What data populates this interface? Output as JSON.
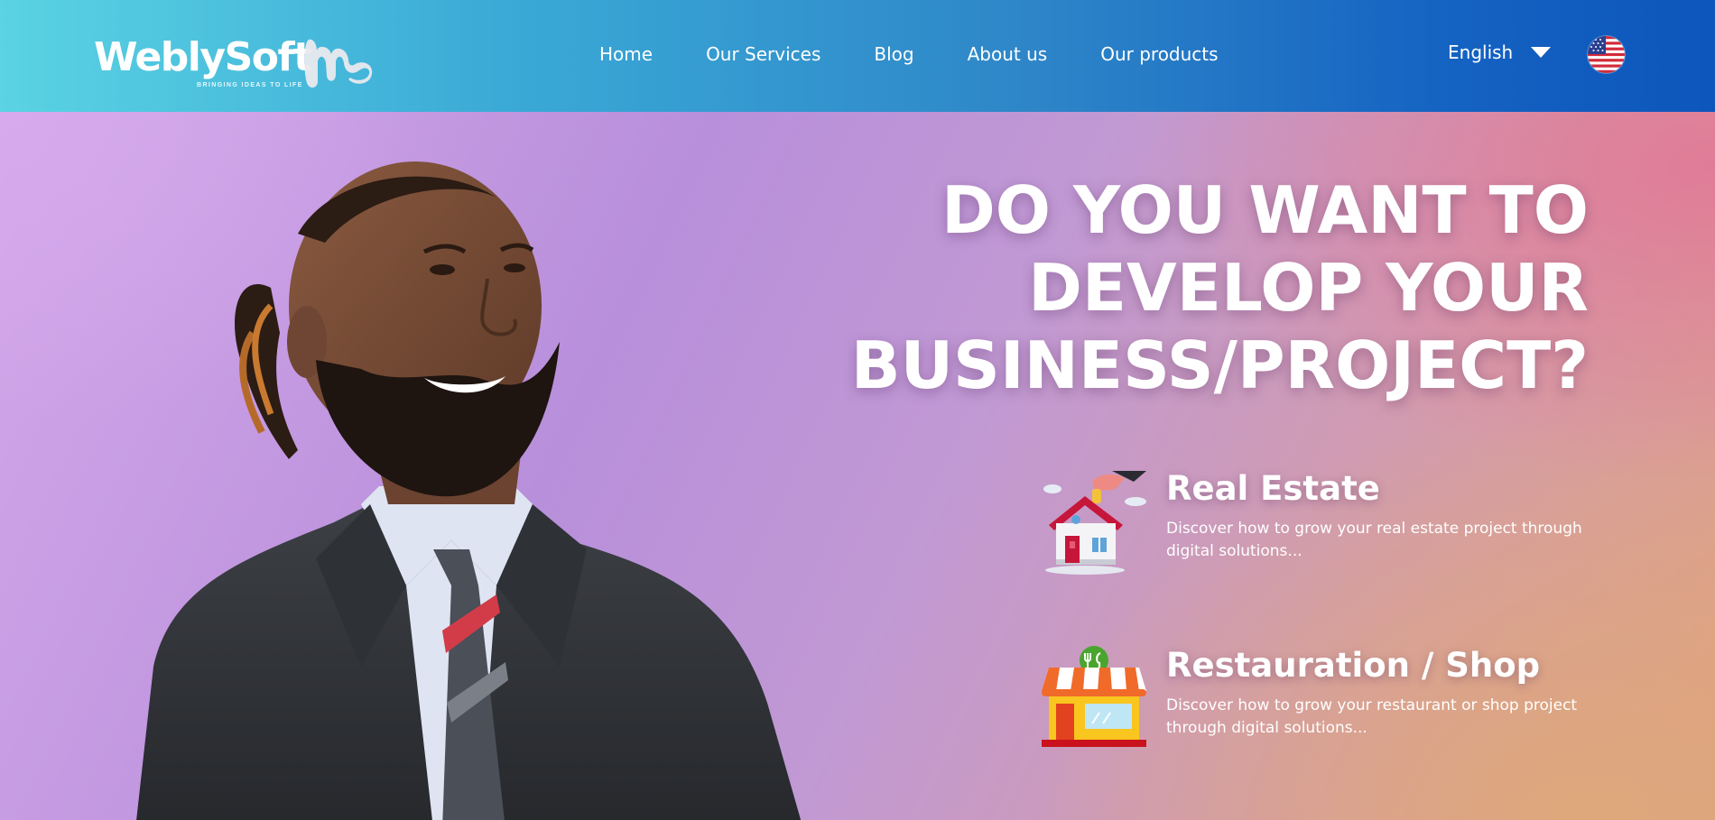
{
  "brand": {
    "name": "WeblySoft",
    "tagline": "BRINGING IDEAS TO LIFE"
  },
  "nav": {
    "items": [
      {
        "label": "Home"
      },
      {
        "label": "Our Services"
      },
      {
        "label": "Blog"
      },
      {
        "label": "About us"
      },
      {
        "label": "Our products"
      }
    ]
  },
  "language": {
    "selected": "English",
    "flag_icon": "us-flag-icon"
  },
  "hero": {
    "headline_lines": [
      "DO YOU WANT TO",
      "DEVELOP YOUR",
      "BUSINESS/PROJECT?"
    ],
    "cards": [
      {
        "icon": "house-coin-icon",
        "title": "Real Estate",
        "description": "Discover how to grow your real estate project through digital solutions..."
      },
      {
        "icon": "shop-storefront-icon",
        "title": "Restauration / Shop",
        "description": "Discover how to grow your restaurant or shop project through digital solutions..."
      }
    ]
  },
  "colors": {
    "header_gradient_start": "#5ad3e3",
    "header_gradient_end": "#0d56bb",
    "hero_purple": "#b88fdb",
    "hero_peach": "#dfa184",
    "hero_pink": "#e27696"
  }
}
